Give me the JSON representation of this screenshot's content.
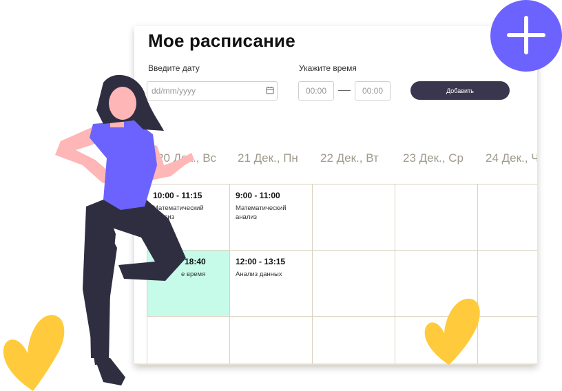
{
  "header": {
    "title": "Мое расписание"
  },
  "form": {
    "date_label": "Введите дату",
    "date_placeholder": "dd/mm/yyyy",
    "time_label": "Укажите время",
    "time_start_placeholder": "00:00",
    "time_end_placeholder": "00:00",
    "add_button_label": "Добавить"
  },
  "days": [
    "20 Дек., Вс",
    "21 Дек., Пн",
    "22 Дек., Вт",
    "23 Дек., Ср",
    "24 Дек., Ч"
  ],
  "events": [
    {
      "time": "10:00 - 11:15",
      "title": "Математический анализ"
    },
    {
      "time": "9:00 - 11:00",
      "title": "Математический анализ"
    },
    {
      "time": "18:40",
      "title": "е время"
    },
    {
      "time": "12:00 - 13:15",
      "title": "Анализ данных"
    }
  ],
  "colors": {
    "accent": "#6c63ff",
    "button": "#3a364d",
    "highlight": "#c6fbea",
    "leaf": "#ffcb3c",
    "figure_dark": "#2f2e41",
    "skin": "#ffb6b6"
  },
  "icons": [
    "calendar-icon",
    "plus-icon"
  ]
}
